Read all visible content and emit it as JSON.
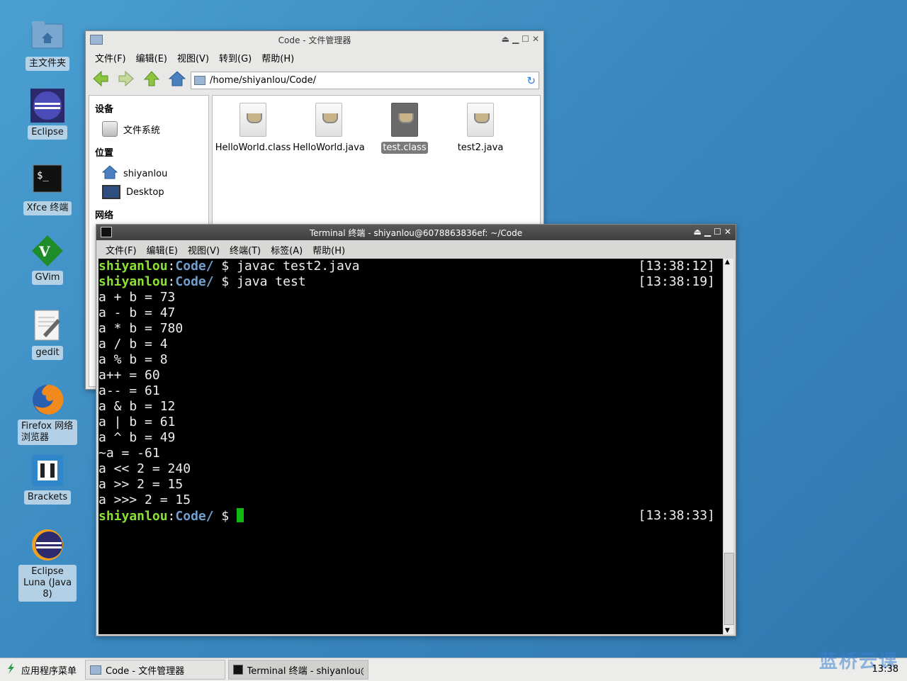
{
  "desktop": {
    "icons": [
      {
        "label": "主文件夹",
        "icon": "home-folder-icon"
      },
      {
        "label": "Eclipse",
        "icon": "eclipse-icon"
      },
      {
        "label": "Xfce 终端",
        "icon": "terminal-icon"
      },
      {
        "label": "GVim",
        "icon": "vim-icon"
      },
      {
        "label": "gedit",
        "icon": "text-editor-icon"
      },
      {
        "label": "Firefox 网络浏览器",
        "icon": "firefox-icon"
      },
      {
        "label": "Brackets",
        "icon": "brackets-icon"
      },
      {
        "label": "Eclipse Luna (Java 8)",
        "icon": "eclipse-luna-icon"
      }
    ]
  },
  "file_manager": {
    "title": "Code - 文件管理器",
    "menu": [
      "文件(F)",
      "编辑(E)",
      "视图(V)",
      "转到(G)",
      "帮助(H)"
    ],
    "path": "/home/shiyanlou/Code/",
    "sidebar": {
      "devices_header": "设备",
      "devices": [
        "文件系统"
      ],
      "places_header": "位置",
      "places": [
        "shiyanlou",
        "Desktop"
      ],
      "network_header": "网络"
    },
    "files": [
      {
        "name": "HelloWorld.class",
        "selected": false
      },
      {
        "name": "HelloWorld.java",
        "selected": false
      },
      {
        "name": "test.class",
        "selected": true
      },
      {
        "name": "test2.java",
        "selected": false
      }
    ]
  },
  "terminal": {
    "title": "Terminal 终端 - shiyanlou@6078863836ef: ~/Code",
    "menu": [
      "文件(F)",
      "编辑(E)",
      "视图(V)",
      "终端(T)",
      "标签(A)",
      "帮助(H)"
    ],
    "prompt_user": "shiyanlou",
    "prompt_dir": "Code/",
    "prompt_symbol": " $ ",
    "commands": [
      {
        "cmd": "javac test2.java",
        "time": "[13:38:12]"
      },
      {
        "cmd": "java test",
        "time": "[13:38:19]"
      }
    ],
    "output": [
      "a + b = 73",
      "a - b = 47",
      "a * b = 780",
      "a / b = 4",
      "a % b = 8",
      "a++ = 60",
      "a-- = 61",
      "a & b = 12",
      "a | b = 61",
      "a ^ b = 49",
      "~a = -61",
      "a << 2 = 240",
      "a >> 2 = 15",
      "a >>> 2 = 15"
    ],
    "last_prompt_time": "[13:38:33]"
  },
  "taskbar": {
    "app_menu": "应用程序菜单",
    "tasks": [
      "Code - 文件管理器",
      "Terminal 终端 - shiyanlou@⋯"
    ],
    "clock": "13:38",
    "watermark": "蓝桥云课"
  }
}
